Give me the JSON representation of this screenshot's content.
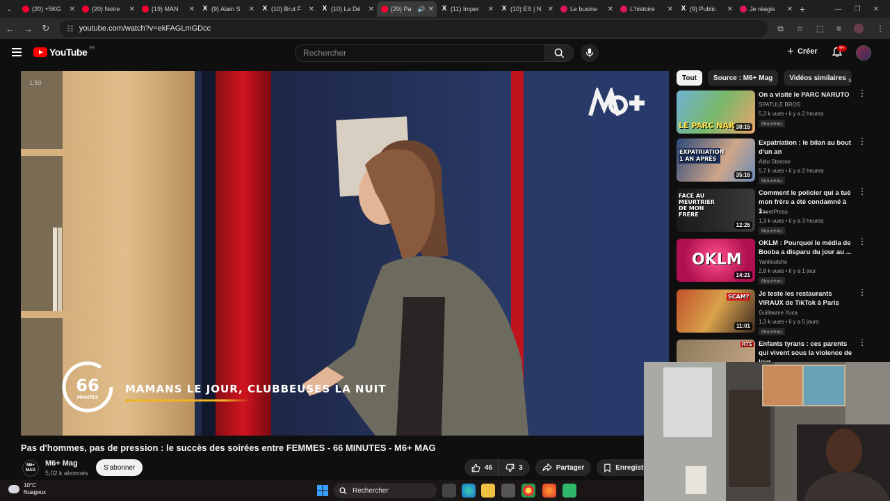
{
  "browser": {
    "tabs": [
      {
        "title": "(20) +5KG",
        "favicon": "youtube-icon",
        "active": false
      },
      {
        "title": "(20) Notre",
        "favicon": "youtube-icon",
        "active": false
      },
      {
        "title": "(19) MAN",
        "favicon": "youtube-icon",
        "active": false
      },
      {
        "title": "(9) Alain S",
        "favicon": "x-icon",
        "active": false
      },
      {
        "title": "(10) Brut F",
        "favicon": "x-icon",
        "active": false
      },
      {
        "title": "(10) La Dé",
        "favicon": "x-icon",
        "active": false
      },
      {
        "title": "(20) Pa",
        "favicon": "youtube-icon",
        "active": true,
        "audio": true
      },
      {
        "title": "(11) Imper",
        "favicon": "x-icon",
        "active": false
      },
      {
        "title": "(10) ES | N",
        "favicon": "x-icon",
        "active": false
      },
      {
        "title": "Le busine",
        "favicon": "site-icon",
        "active": false
      },
      {
        "title": "L'histoire",
        "favicon": "site-icon",
        "active": false
      },
      {
        "title": "(9) Public",
        "favicon": "x-icon",
        "active": false
      },
      {
        "title": "Je réagis",
        "favicon": "site-icon",
        "active": false
      }
    ],
    "url": "youtube.com/watch?v=ekFAGLmGDcc"
  },
  "header": {
    "logo": "YouTube",
    "region": "FR",
    "search_placeholder": "Rechercher",
    "create_label": "Créer",
    "notif_count": "9+"
  },
  "player": {
    "speed_overlay": "1.50",
    "show_badge": "66",
    "show_badge_sub": "MINUTES",
    "banner_text": "MAMANS LE JOUR, CLUBBEUSES LA NUIT"
  },
  "video": {
    "title": "Pas d'hommes, pas de pression : le succès des soirées entre FEMMES - 66 MINUTES - M6+ MAG",
    "channel": "M6+ Mag",
    "channel_avatar_text": "M6+ MAG",
    "subscribers": "5,02 k abonnés",
    "subscribe_label": "S'abonner",
    "likes": "46",
    "dislikes": "3",
    "share_label": "Partager",
    "save_label": "Enregistrer"
  },
  "chips": [
    "Tout",
    "Source : M6+ Mag",
    "Vidéos similaires"
  ],
  "recommendations": [
    {
      "title": "On a visité le PARC NARUTO",
      "channel": "SPATULE BROS",
      "meta": "5,3 k vues • il y a 2 heures",
      "new": "Nouveau",
      "duration": "38:15",
      "thumb_text": "LE PARC NAR"
    },
    {
      "title": "Expatriation : le bilan au bout d'un an",
      "channel": "Aldo Sterone",
      "meta": "5,7 k vues • il y a 2 heures",
      "new": "Nouveau",
      "duration": "35:16",
      "thumb_text": "EXPATRIATION 1 AN APRÈS"
    },
    {
      "title": "Comment le policier qui a tué mon frère a été condamné à 1...",
      "channel": "StreetPress",
      "meta": "1,3 k vues • il y a 3 heures",
      "new": "Nouveau",
      "duration": "12:26",
      "thumb_text": "FACE AU MEURTRIER DE MON FRÈRE"
    },
    {
      "title": "OKLM : Pourquoi le média de Booba a disparu du jour au ...",
      "channel": "Yaniloutcho",
      "meta": "2,8 k vues • il y a 1 jour",
      "new": "Nouveau",
      "duration": "14:21",
      "thumb_text": "OKLM"
    },
    {
      "title": "Je teste les restaurants VIRAUX de TikTok à Paris",
      "channel": "Guillaume Yuca",
      "meta": "1,3 k vues • il y a 5 jours",
      "new": "Nouveau",
      "duration": "11:01",
      "thumb_text": "SCAM?"
    },
    {
      "title": "Enfants tyrans : ces parents qui vivent sous la violence de leur ...",
      "channel": "",
      "meta": "",
      "new": "",
      "duration": "",
      "thumb_text": "RTS"
    }
  ],
  "taskbar": {
    "temperature": "10°C",
    "weather": "Nuageux",
    "search_label": "Rechercher"
  },
  "colors": {
    "brand": "#ff0000",
    "accent_yellow": "#f0b323",
    "background": "#0f0f0f"
  }
}
